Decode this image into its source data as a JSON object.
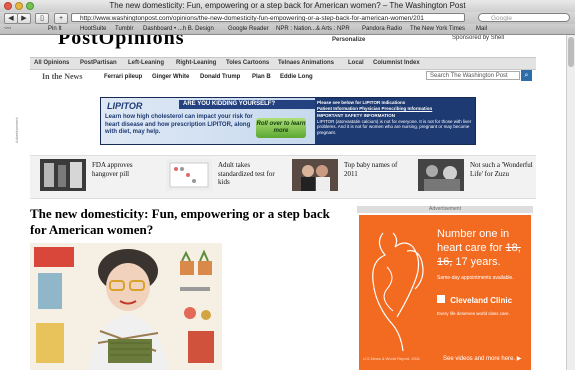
{
  "window": {
    "title": "The new domesticity: Fun, empowering or a step back for American women? – The Washington Post"
  },
  "toolbar": {
    "url": "http://www.washingtonpost.com/opinions/the-new-domesticity-fun-empowering-or-a-step-back-for-american-women/201",
    "search_placeholder": "Google"
  },
  "bookmarks": [
    "Pin It",
    "HootSuite",
    "Tumblr",
    "Dashboard • ...h B. Design",
    "Google Reader",
    "NPR : Nation...& Arts : NPR",
    "Pandora Radio",
    "The New York Times",
    "Mail"
  ],
  "header": {
    "masthead": "PostOpinions",
    "personalize": "Personalize",
    "sponsored": "Sponsored by Shell"
  },
  "nav": {
    "sections": [
      "All Opinions",
      "PostPartisan",
      "Left-Leaning",
      "Right-Leaning",
      "Toles Cartoons",
      "Telnaes Animations",
      "Local",
      "Columnist Index"
    ],
    "in_the_news_label": "In the News",
    "in_the_news": [
      "Ferrari pileup",
      "Ginger White",
      "Donald Trump",
      "Plan B",
      "Eddie Long"
    ],
    "site_search_placeholder": "Search The Washington Post"
  },
  "banner_ad": {
    "label": "Advertisement",
    "logo": "LIPITOR",
    "ask": "ARE YOU KIDDING YOURSELF?",
    "body": "Learn how high cholesterol can impact your risk for heart disease and how prescription LIPITOR, along with diet, may help.",
    "cta": "Roll over to learn more",
    "right_head": "Please see below for LIPITOR Indications",
    "right_links": "Patient Information   Physician Prescribing Information",
    "right_safety_title": "IMPORTANT SAFETY INFORMATION",
    "right_safety_text": "LIPITOR (atorvastatin calcium) is not for everyone. It is not for those with liver problems. And it is not for women who are nursing, pregnant or may become pregnant."
  },
  "news_items": [
    {
      "text": "FDA approves hangover pill"
    },
    {
      "text": "Adult takes standardized test for kids"
    },
    {
      "text": "Top baby names of 2011"
    },
    {
      "text": "Not such a 'Wonderful Life' for Zuzu"
    }
  ],
  "article": {
    "headline": "The new domesticity: Fun, empowering or a step back for American women?"
  },
  "side_ad": {
    "label": "Advertisement",
    "line1": "Number one in heart care for",
    "years_old1": "18,",
    "years_old2": "16,",
    "years_new": "17 years.",
    "small": "Same-day appointments available.",
    "logo": "Cleveland Clinic",
    "note": "Every life deserves world class care.",
    "footnote": "U.S.News & World Report, 2011",
    "video": "See videos and more here."
  },
  "colors": {
    "ad_orange": "#f26b21",
    "banner_navy": "#1e3a73",
    "nav_bg": "#e3e3e3"
  }
}
